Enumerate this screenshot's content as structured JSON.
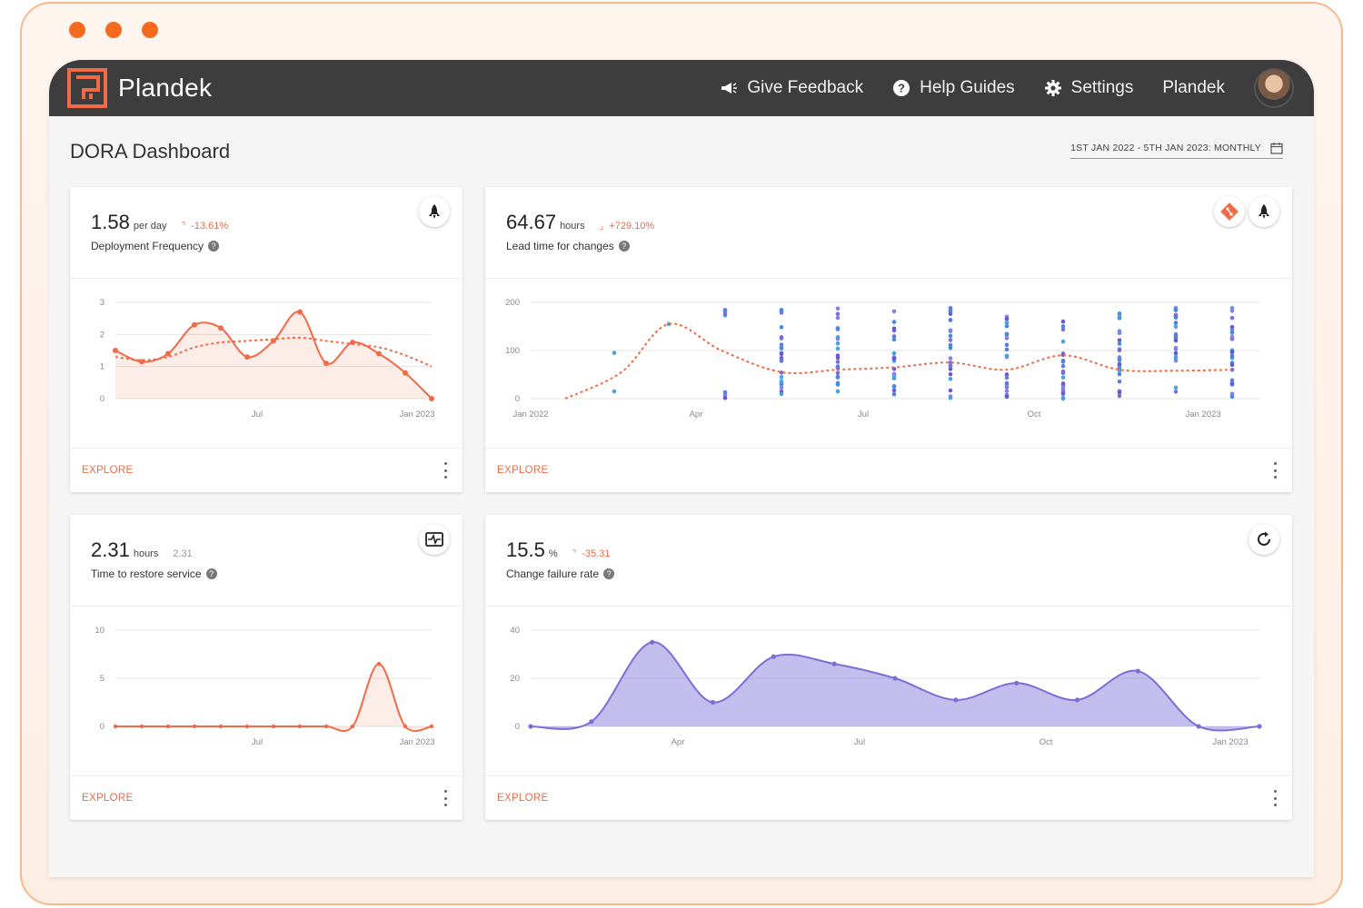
{
  "topbar": {
    "brand": "Plandek",
    "nav": [
      {
        "label": "Give Feedback",
        "icon": "megaphone-icon"
      },
      {
        "label": "Help Guides",
        "icon": "help-circle-icon"
      },
      {
        "label": "Settings",
        "icon": "gear-icon"
      }
    ],
    "user_name": "Plandek"
  },
  "page": {
    "title": "DORA Dashboard",
    "date_range": "1ST JAN 2022 - 5TH JAN 2023: MONTHLY"
  },
  "colors": {
    "accent": "#f06b46",
    "purple": "#7b6fd6",
    "topbar": "#3d3d3d"
  },
  "cards": {
    "deploy": {
      "value": "1.58",
      "unit": "per day",
      "change": "-13.61%",
      "label": "Deployment Frequency",
      "explore": "EXPLORE"
    },
    "lead": {
      "value": "64.67",
      "unit": "hours",
      "change": "+729.10%",
      "label": "Lead time for changes",
      "explore": "EXPLORE"
    },
    "restore": {
      "value": "2.31",
      "unit": "hours",
      "change": "2.31",
      "label": "Time to restore service",
      "explore": "EXPLORE"
    },
    "cfr": {
      "value": "15.5",
      "unit": "%",
      "change": "-35.31",
      "label": "Change failure rate",
      "explore": "EXPLORE"
    }
  },
  "chart_data": [
    {
      "type": "area",
      "yticks": [
        "0",
        "1",
        "2",
        "3"
      ],
      "xticks": [
        "Jul",
        "Jan 2023"
      ],
      "ylim": [
        0,
        3
      ],
      "values": [
        1.5,
        1.15,
        1.4,
        2.3,
        2.2,
        1.3,
        1.8,
        2.7,
        1.1,
        1.75,
        1.4,
        0.8,
        0.0
      ],
      "trend": [
        1.3,
        1.2,
        1.3,
        1.6,
        1.75,
        1.8,
        1.85,
        1.9,
        1.8,
        1.7,
        1.6,
        1.35,
        1.0
      ]
    },
    {
      "type": "scatter",
      "yticks": [
        "0",
        "100",
        "200"
      ],
      "xticks": [
        "Jan 2022",
        "Apr",
        "Jul",
        "Oct",
        "Jan 2023"
      ],
      "ylim": [
        0,
        200
      ],
      "trend": [
        0,
        60,
        155,
        100,
        60,
        65,
        75,
        60,
        90,
        60,
        60,
        60
      ]
    },
    {
      "type": "area",
      "yticks": [
        "0",
        "5",
        "10"
      ],
      "xticks": [
        "Jul",
        "Jan 2023"
      ],
      "ylim": [
        0,
        10
      ],
      "values": [
        0,
        0,
        0,
        0,
        0,
        0,
        0,
        0,
        0,
        0,
        6.5,
        0,
        0
      ]
    },
    {
      "type": "area",
      "yticks": [
        "0",
        "20",
        "40"
      ],
      "xticks": [
        "Apr",
        "Jul",
        "Oct",
        "Jan 2023"
      ],
      "ylim": [
        0,
        40
      ],
      "values": [
        0,
        2,
        35,
        10,
        29,
        26,
        20,
        11,
        18,
        11,
        23,
        0,
        0
      ]
    }
  ]
}
